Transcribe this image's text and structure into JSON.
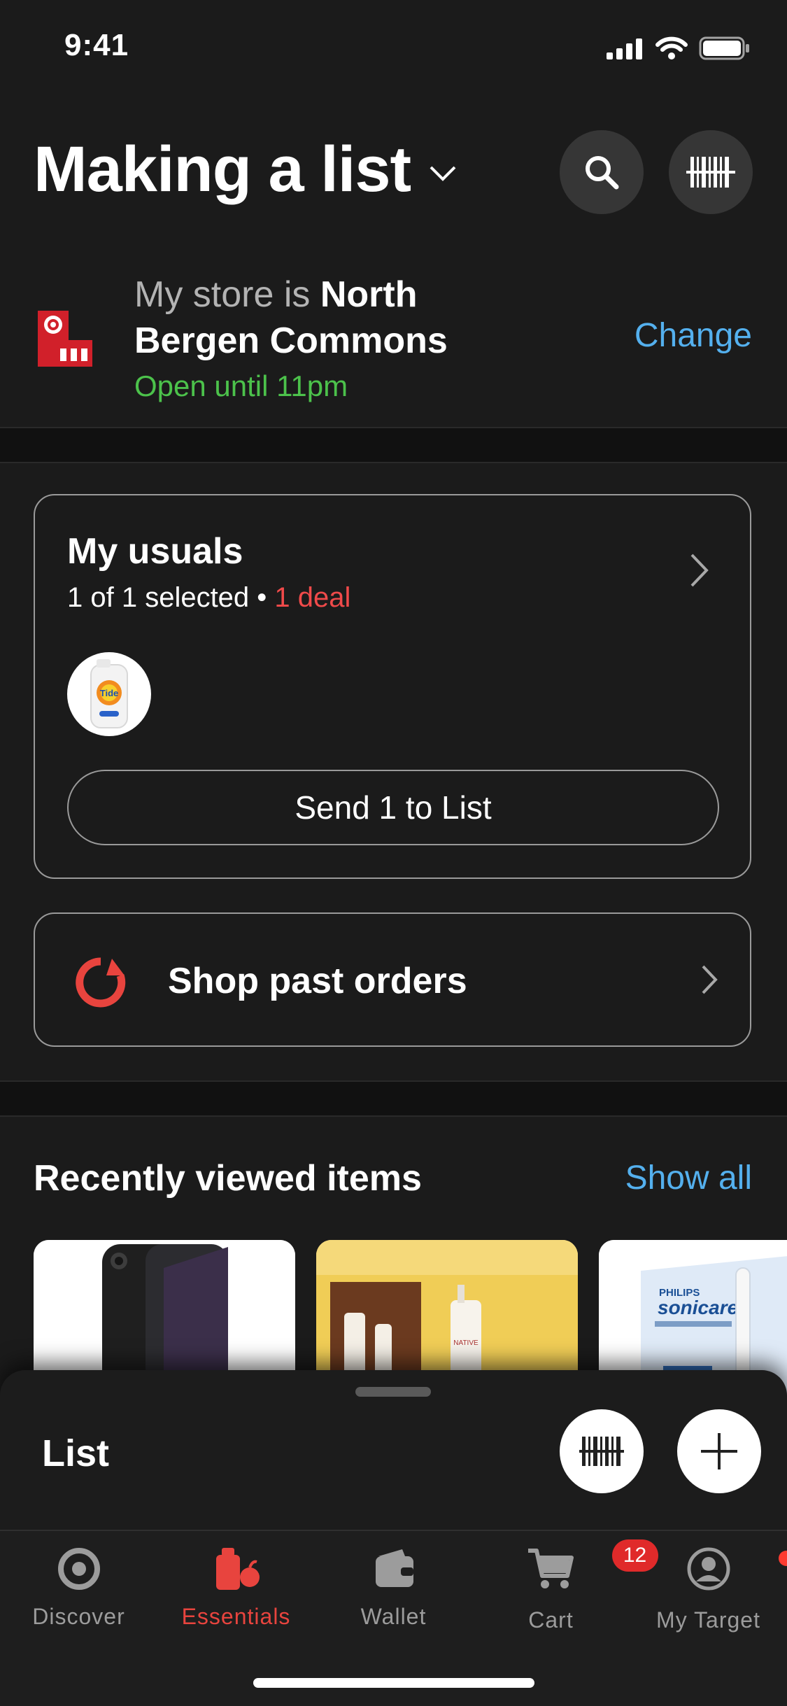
{
  "status": {
    "time": "9:41"
  },
  "header": {
    "title": "Making a list"
  },
  "store": {
    "prefix": "My store is ",
    "name_line1": "North",
    "name_line2": "Bergen Commons",
    "hours": "Open until 11pm",
    "change_label": "Change"
  },
  "usuals": {
    "title": "My usuals",
    "selected": "1 of 1 selected",
    "separator": " • ",
    "deal": "1 deal",
    "thumb_text": "Tide",
    "send_label": "Send 1 to List"
  },
  "past_orders": {
    "label": "Shop past orders"
  },
  "recent": {
    "title": "Recently viewed items",
    "show_all": "Show all",
    "items": [
      {
        "icon": "phone-product-image"
      },
      {
        "icon": "native-products-image",
        "brand": "NATIVE"
      },
      {
        "icon": "toothbrush-product-image",
        "brand": "PHILIPS",
        "product": "sonicare"
      }
    ]
  },
  "sheet": {
    "label": "List"
  },
  "tabs": [
    {
      "label": "Discover",
      "icon": "discover-icon"
    },
    {
      "label": "Essentials",
      "icon": "essentials-icon",
      "active": true
    },
    {
      "label": "Wallet",
      "icon": "wallet-icon"
    },
    {
      "label": "Cart",
      "icon": "cart-icon",
      "badge": "12"
    },
    {
      "label": "My Target",
      "icon": "profile-icon"
    }
  ],
  "colors": {
    "accent_red": "#e8443e",
    "link_blue": "#54b0ee",
    "open_green": "#4cc24b"
  }
}
